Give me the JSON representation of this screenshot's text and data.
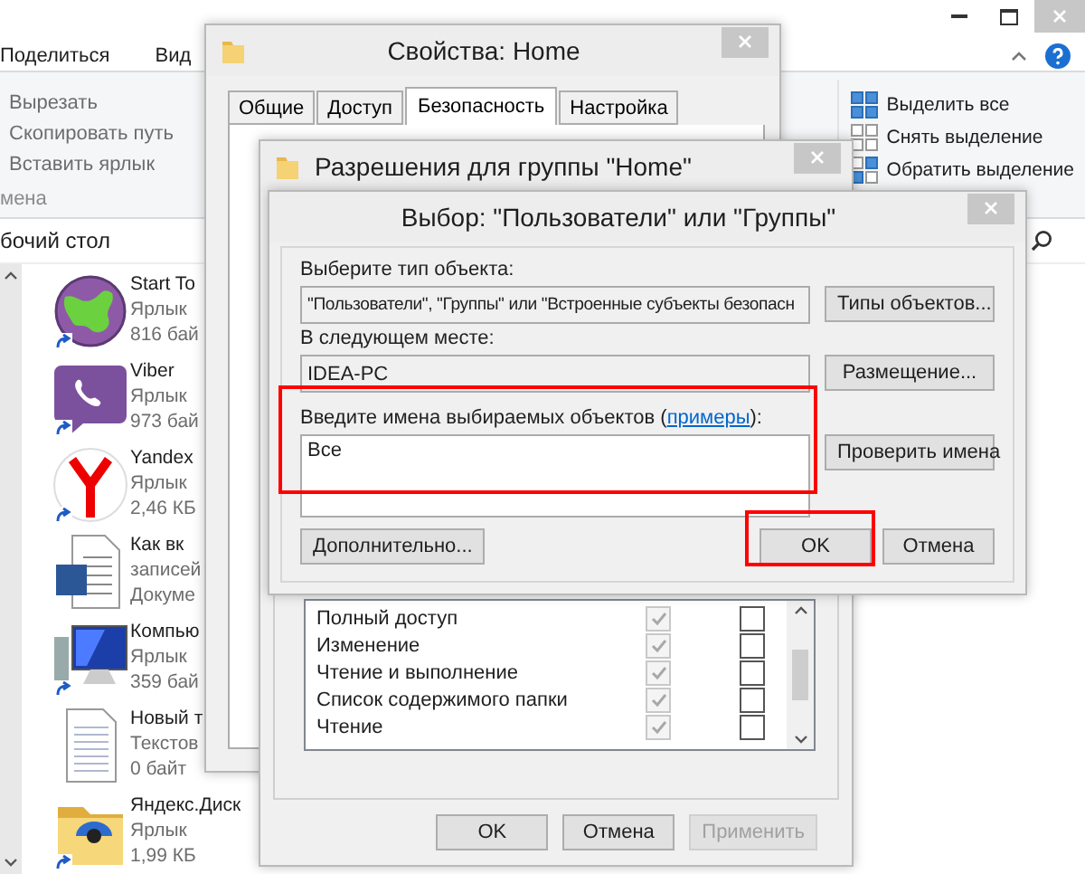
{
  "explorer": {
    "ribbon_tabs": [
      "Поделиться",
      "Вид"
    ],
    "clipboard_items": [
      "Вырезать",
      "Скопировать путь",
      "Вставить ярлык"
    ],
    "clipboard_group": "мена",
    "select_items": [
      {
        "label": "Выделить все",
        "kind": "all"
      },
      {
        "label": "Снять выделение",
        "kind": "none"
      },
      {
        "label": "Обратить выделение",
        "kind": "invert"
      }
    ],
    "address": "бочий стол",
    "files": [
      {
        "name": "Start To",
        "line2": "Ярлык",
        "line3": "816 бай",
        "kind": "globe",
        "shortcut": true
      },
      {
        "name": "Viber",
        "line2": "Ярлык",
        "line3": "973 бай",
        "kind": "chat",
        "shortcut": true
      },
      {
        "name": "Yandex",
        "line2": "Ярлык",
        "line3": "2,46 КБ",
        "kind": "browser",
        "shortcut": true
      },
      {
        "name": "Как вк",
        "line2": "записей",
        "line3": "Докуме",
        "kind": "document",
        "shortcut": false
      },
      {
        "name": "Компью",
        "line2": "Ярлык",
        "line3": "359 бай",
        "kind": "computer",
        "shortcut": true
      },
      {
        "name": "Новый т",
        "line2": "Текстов",
        "line3": "0 байт",
        "kind": "text",
        "shortcut": false
      },
      {
        "name": "Яндекс.Диск",
        "line2": "Ярлык",
        "line3": "1,99 КБ",
        "kind": "folder",
        "shortcut": true
      }
    ]
  },
  "properties": {
    "title": "Свойства: Home",
    "tabs": [
      {
        "label": "Общие",
        "selected": false
      },
      {
        "label": "Доступ",
        "selected": false
      },
      {
        "label": "Безопасность",
        "selected": true
      },
      {
        "label": "Настройка",
        "selected": false
      }
    ]
  },
  "permissions": {
    "title": "Разрешения для группы \"Home\"",
    "rows": [
      {
        "label": "Полный доступ",
        "allow_checked": true,
        "allow_disabled": true,
        "deny_checked": false
      },
      {
        "label": "Изменение",
        "allow_checked": true,
        "allow_disabled": true,
        "deny_checked": false
      },
      {
        "label": "Чтение и выполнение",
        "allow_checked": true,
        "allow_disabled": true,
        "deny_checked": false
      },
      {
        "label": "Список содержимого папки",
        "allow_checked": true,
        "allow_disabled": true,
        "deny_checked": false
      },
      {
        "label": "Чтение",
        "allow_checked": true,
        "allow_disabled": true,
        "deny_checked": false
      }
    ],
    "buttons": [
      {
        "label": "OK",
        "disabled": false
      },
      {
        "label": "Отмена",
        "disabled": false
      },
      {
        "label": "Применить",
        "disabled": true
      }
    ]
  },
  "select": {
    "title": "Выбор: \"Пользователи\" или \"Группы\"",
    "type_label": "Выберите тип объекта:",
    "type_value": "\"Пользователи\", \"Группы\" или \"Встроенные субъекты безопасн",
    "type_button": "Типы объектов...",
    "location_label": "В следующем месте:",
    "location_value": "IDEA-PC",
    "location_button": "Размещение...",
    "names_label_before": "Введите имена выбираемых объектов (",
    "names_link": "примеры",
    "names_label_after": "):",
    "names_value": "Все",
    "check_button": "Проверить имена",
    "advanced_button": "Дополнительно...",
    "ok_button": "OK",
    "cancel_button": "Отмена",
    "names_highlighted": true,
    "ok_highlighted": true
  }
}
